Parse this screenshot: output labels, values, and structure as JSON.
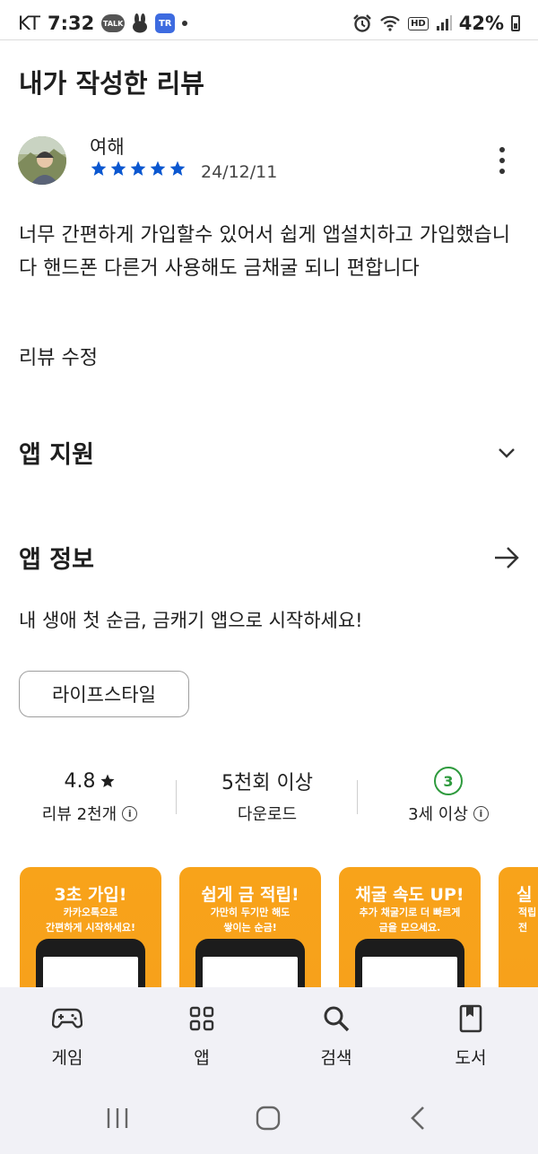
{
  "status_bar": {
    "carrier": "KT",
    "time": "7:32",
    "talk_badge": "TALK",
    "tr_badge": "TR",
    "hd_badge": "HD",
    "battery": "42%"
  },
  "page_title": "내가 작성한 리뷰",
  "review": {
    "reviewer_name": "여해",
    "rating": 5,
    "date": "24/12/11",
    "body": "너무 간편하게 가입할수 있어서 쉽게 앱설치하고 가입했습니다 핸드폰 다른거 사용해도 금채굴 되니 편합니다",
    "edit_label": "리뷰 수정"
  },
  "sections": {
    "app_support": "앱 지원",
    "app_info": "앱 정보"
  },
  "app_description": "내 생애 첫 순금, 금캐기 앱으로 시작하세요!",
  "category_chip": "라이프스타일",
  "stats": {
    "rating_value": "4.8",
    "rating_label": "리뷰 2천개",
    "downloads_value": "5천회 이상",
    "downloads_label": "다운로드",
    "age_badge": "3",
    "age_label": "3세 이상"
  },
  "screenshots": [
    {
      "heading": "3초 가입!",
      "sub1": "카카오톡으로",
      "sub2": "간편하게 시작하세요!"
    },
    {
      "heading": "쉽게 금 적립!",
      "sub1": "가만히 두기만 해도",
      "sub2": "쌓이는 순금!"
    },
    {
      "heading": "채굴 속도 UP!",
      "sub1": "추가 채굴기로 더 빠르게",
      "sub2": "금을 모으세요."
    },
    {
      "heading": "실",
      "sub1": "적립",
      "sub2": "전"
    }
  ],
  "bottom_nav": {
    "games": "게임",
    "apps": "앱",
    "search": "검색",
    "books": "도서"
  },
  "colors": {
    "star_blue": "#0b57d0",
    "promo_orange": "#f8a31a",
    "age_green": "#2e9a3d",
    "nav_bg": "#f1f1f6"
  }
}
